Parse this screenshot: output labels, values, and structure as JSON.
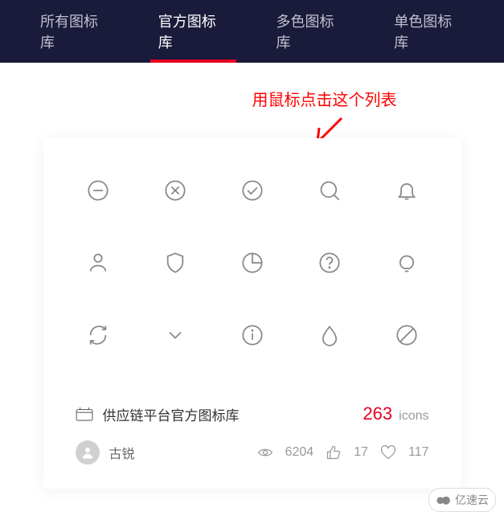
{
  "tabs": {
    "items": [
      {
        "label": "所有图标库",
        "active": false
      },
      {
        "label": "官方图标库",
        "active": true
      },
      {
        "label": "多色图标库",
        "active": false
      },
      {
        "label": "单色图标库",
        "active": false
      }
    ]
  },
  "annotation": {
    "text": "用鼠标点击这个列表"
  },
  "icons": [
    "minus-circle",
    "close-circle",
    "check-circle",
    "search",
    "bell",
    "user",
    "shield",
    "pie-chart",
    "question-circle",
    "lightbulb",
    "refresh",
    "chevron-down",
    "info-circle",
    "droplet",
    "ban"
  ],
  "library": {
    "title": "供应链平台官方图标库",
    "count": "263",
    "count_label": "icons"
  },
  "author": {
    "name": "古锐"
  },
  "stats": {
    "views": "6204",
    "likes": "17",
    "favorites": "117"
  },
  "watermark": {
    "text": "亿速云"
  },
  "colors": {
    "accent": "#e60021",
    "nav_bg": "#1a1a3a"
  }
}
